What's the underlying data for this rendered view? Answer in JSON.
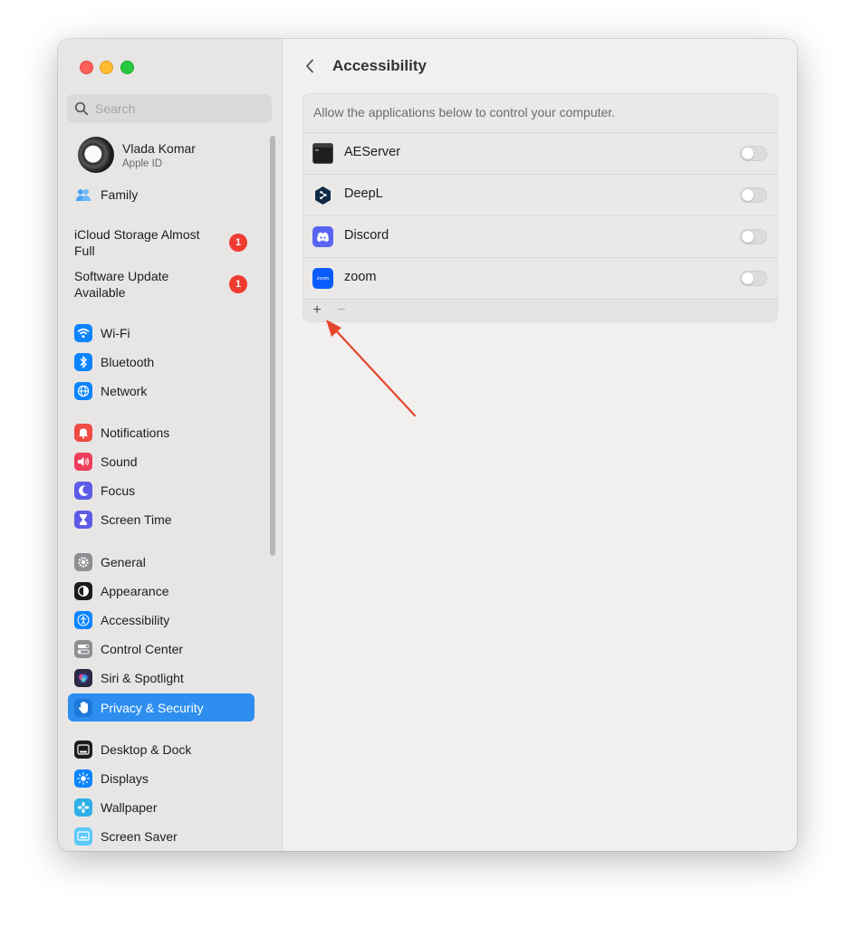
{
  "window": {
    "title": "Accessibility"
  },
  "search": {
    "placeholder": "Search"
  },
  "user": {
    "name": "Vlada Komar",
    "subtitle": "Apple ID"
  },
  "sidebar": {
    "family": {
      "label": "Family",
      "icon": "family-icon"
    },
    "alerts": [
      {
        "label": "iCloud Storage Almost Full",
        "count": "1"
      },
      {
        "label": "Software Update Available",
        "count": "1"
      }
    ],
    "items": [
      {
        "label": "Wi-Fi",
        "icon": "wifi-icon",
        "color": "#0a84ff"
      },
      {
        "label": "Bluetooth",
        "icon": "bluetooth-icon",
        "color": "#0a84ff"
      },
      {
        "label": "Network",
        "icon": "globe-icon",
        "color": "#0a84ff"
      },
      {
        "label": "Notifications",
        "icon": "bell-icon",
        "color": "#ef4b45"
      },
      {
        "label": "Sound",
        "icon": "speaker-icon",
        "color": "#ef3f5b"
      },
      {
        "label": "Focus",
        "icon": "moon-icon",
        "color": "#5e5ce6"
      },
      {
        "label": "Screen Time",
        "icon": "hourglass-icon",
        "color": "#5e5ce6"
      },
      {
        "label": "General",
        "icon": "gear-icon",
        "color": "#8e8e93"
      },
      {
        "label": "Appearance",
        "icon": "appearance-icon",
        "color": "#1c1c1e"
      },
      {
        "label": "Accessibility",
        "icon": "accessibility-icon",
        "color": "#0a84ff"
      },
      {
        "label": "Control Center",
        "icon": "control-center-icon",
        "color": "#8e8e93"
      },
      {
        "label": "Siri & Spotlight",
        "icon": "siri-icon",
        "color": "#3a3a5c"
      },
      {
        "label": "Privacy & Security",
        "icon": "hand-icon",
        "color": "#0a84ff",
        "selected": true
      },
      {
        "label": "Desktop & Dock",
        "icon": "dock-icon",
        "color": "#1c1c1e"
      },
      {
        "label": "Displays",
        "icon": "sun-icon",
        "color": "#0a84ff"
      },
      {
        "label": "Wallpaper",
        "icon": "flower-icon",
        "color": "#30b0e8"
      },
      {
        "label": "Screen Saver",
        "icon": "screen-saver-icon",
        "color": "#5ac8fa"
      }
    ]
  },
  "main": {
    "title": "Accessibility",
    "description": "Allow the applications below to control your computer.",
    "apps": [
      {
        "name": "AEServer",
        "icon": "terminal-icon",
        "enabled": false
      },
      {
        "name": "DeepL",
        "icon": "deepl-icon",
        "enabled": false
      },
      {
        "name": "Discord",
        "icon": "discord-icon",
        "enabled": false
      },
      {
        "name": "zoom",
        "icon": "zoom-icon",
        "icon_text": "zoom",
        "enabled": false
      }
    ],
    "add_label": "+",
    "remove_label": "−"
  },
  "colors": {
    "accent": "#2d8ef0",
    "badge": "#ef3b30",
    "annotation_arrow": "#e5452d"
  }
}
